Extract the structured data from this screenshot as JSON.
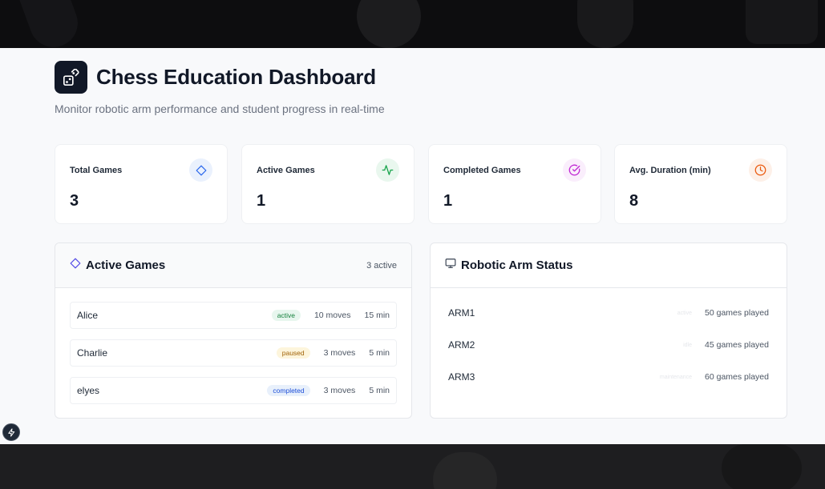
{
  "header": {
    "title": "Chess Education Dashboard",
    "subtitle": "Monitor robotic arm performance and student progress in real-time"
  },
  "stats": [
    {
      "label": "Total Games",
      "value": "3",
      "icon": "diamond-icon",
      "color": "#2563eb",
      "bg": "#eaf1fd"
    },
    {
      "label": "Active Games",
      "value": "1",
      "icon": "activity-icon",
      "color": "#16a34a",
      "bg": "#e9f7ee"
    },
    {
      "label": "Completed Games",
      "value": "1",
      "icon": "check-circle-icon",
      "color": "#c026d3",
      "bg": "#faeefc"
    },
    {
      "label": "Avg. Duration (min)",
      "value": "8",
      "icon": "clock-icon",
      "color": "#ea580c",
      "bg": "#fdf0e8"
    }
  ],
  "active_games": {
    "title": "Active Games",
    "count_label": "3 active",
    "rows": [
      {
        "name": "Alice",
        "status": "active",
        "moves": "10 moves",
        "duration": "15 min",
        "badge_bg": "#e7f6ee",
        "badge_fg": "#15803d"
      },
      {
        "name": "Charlie",
        "status": "paused",
        "moves": "3 moves",
        "duration": "5 min",
        "badge_bg": "#fdf5dc",
        "badge_fg": "#a16207"
      },
      {
        "name": "elyes",
        "status": "completed",
        "moves": "3 moves",
        "duration": "5 min",
        "badge_bg": "#e8f0fb",
        "badge_fg": "#1d4ed8"
      }
    ]
  },
  "robotic_arms": {
    "title": "Robotic Arm Status",
    "rows": [
      {
        "name": "ARM1",
        "status": "active",
        "games": "50 games played"
      },
      {
        "name": "ARM2",
        "status": "idle",
        "games": "45 games played"
      },
      {
        "name": "ARM3",
        "status": "maintenance",
        "games": "60 games played"
      }
    ]
  }
}
